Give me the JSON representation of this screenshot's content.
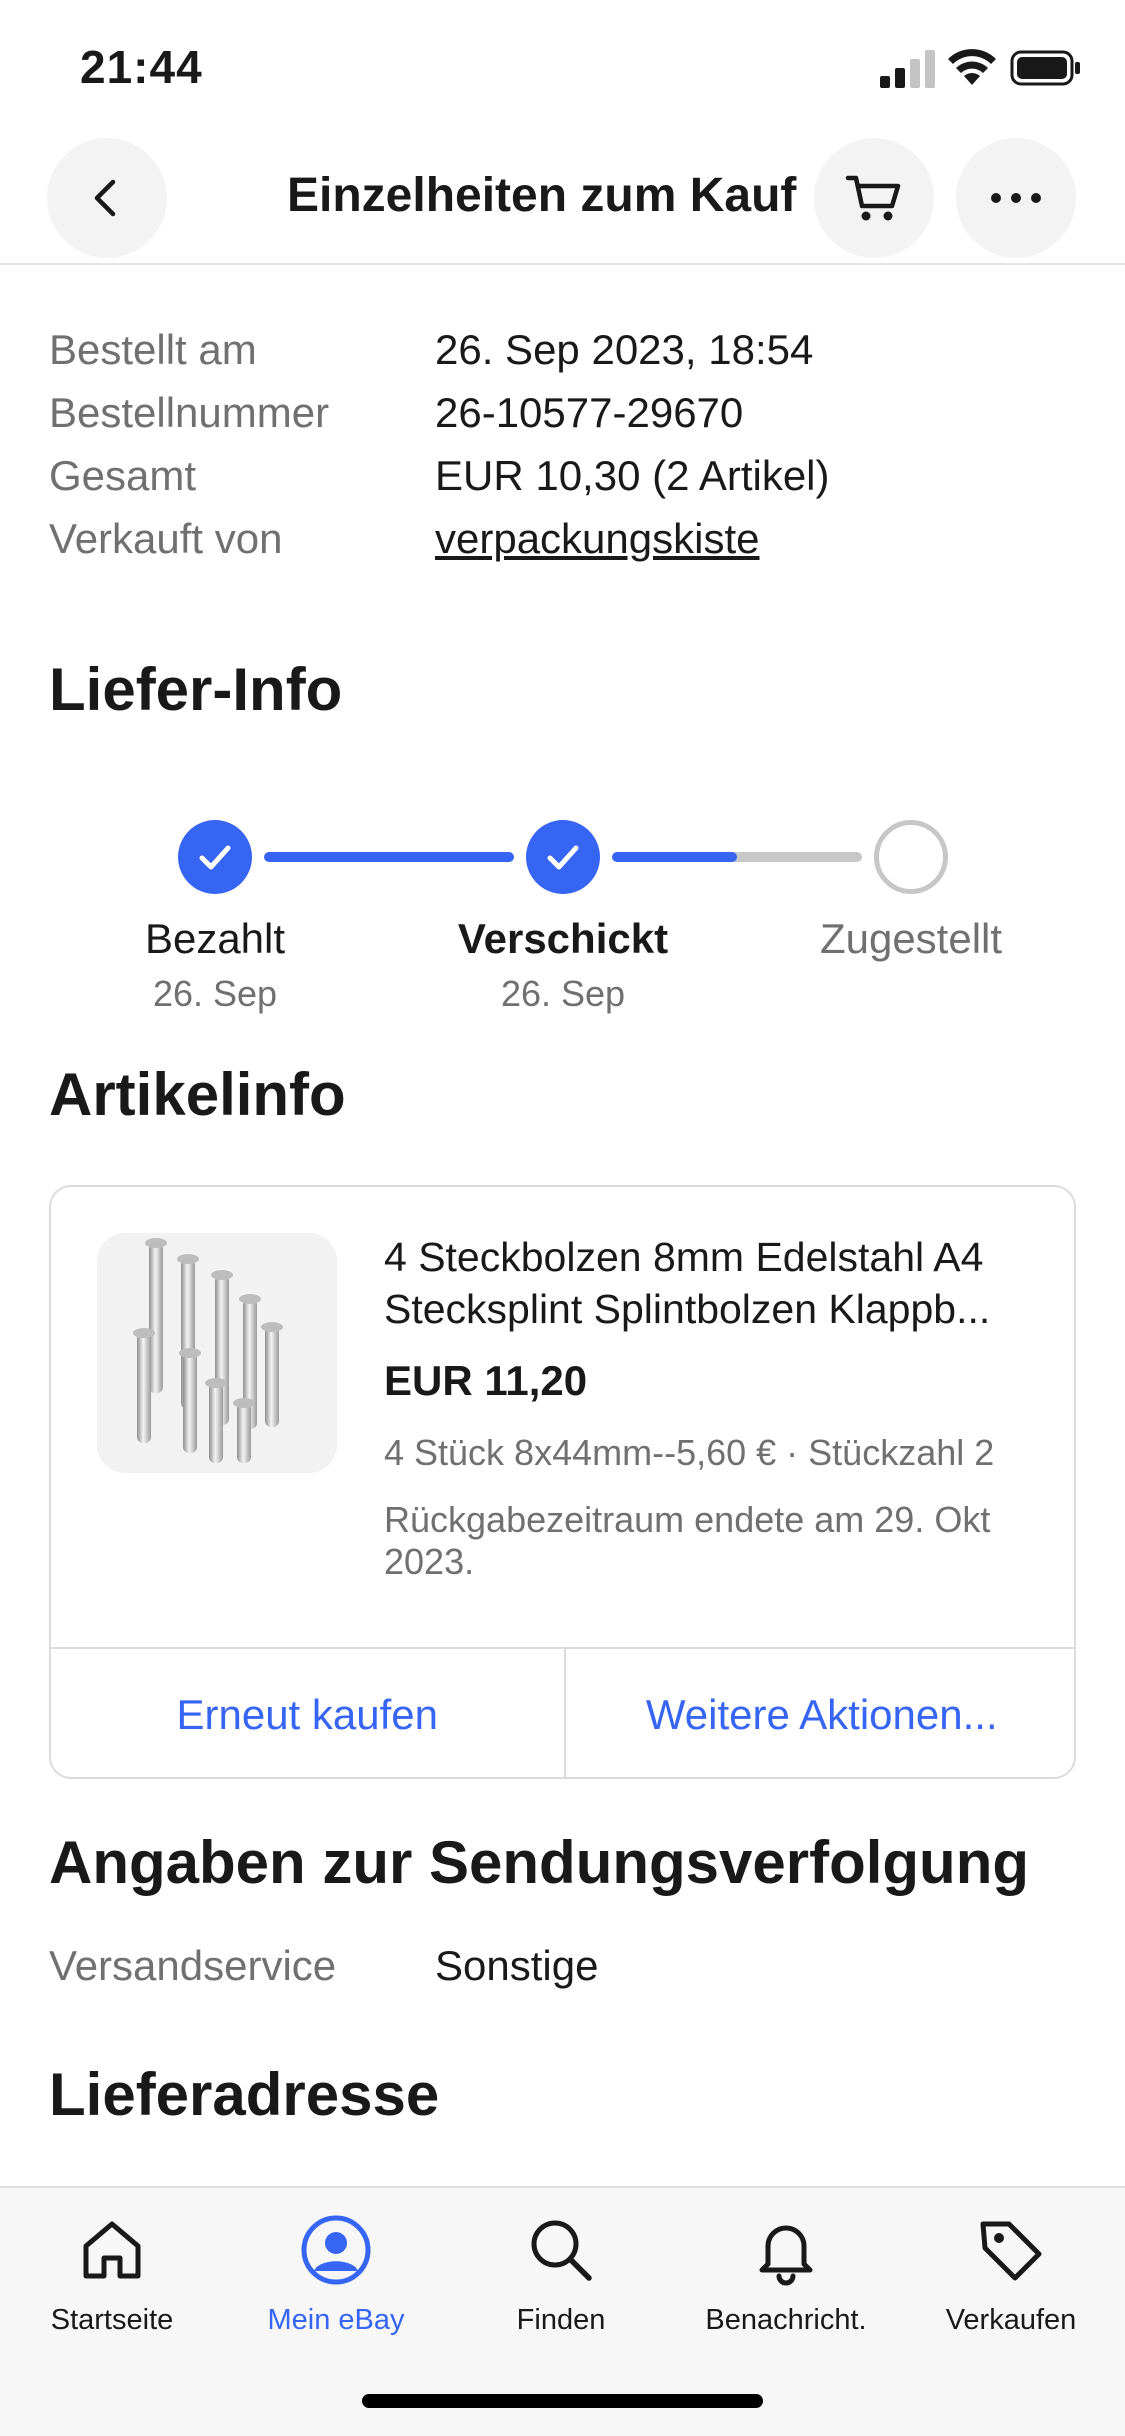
{
  "status_bar": {
    "time": "21:44"
  },
  "nav": {
    "title": "Einzelheiten zum Kauf",
    "back_icon": "chevron-left-icon",
    "cart_icon": "cart-icon",
    "more_icon": "more-horizontal-icon"
  },
  "order": {
    "rows": [
      {
        "label": "Bestellt am",
        "value": "26. Sep 2023, 18:54"
      },
      {
        "label": "Bestellnummer",
        "value": "26-10577-29670"
      },
      {
        "label": "Gesamt",
        "value": "EUR 10,30 (2 Artikel)"
      },
      {
        "label": "Verkauft von",
        "value": "verpackungskiste"
      }
    ]
  },
  "delivery": {
    "heading": "Liefer-Info",
    "steps": [
      {
        "label": "Bezahlt",
        "date": "26. Sep",
        "state": "done"
      },
      {
        "label": "Verschickt",
        "date": "26. Sep",
        "state": "done"
      },
      {
        "label": "Zugestellt",
        "date": "",
        "state": "pending"
      }
    ],
    "transit_progress": 0.5
  },
  "item_info": {
    "heading": "Artikelinfo",
    "title": "4 Steckbolzen 8mm Edelstahl A4 Stecksplint Splintbolzen Klappb...",
    "price": "EUR 11,20",
    "variant": "4 Stück 8x44mm--5,60 € · Stückzahl 2",
    "return_note": "Rückgabezeitraum endete am 29. Okt 2023.",
    "actions": {
      "buy_again": "Erneut kaufen",
      "more_actions": "Weitere Aktionen..."
    }
  },
  "tracking": {
    "heading": "Angaben zur Sendungsverfolgung",
    "service_label": "Versandservice",
    "service_value": "Sonstige"
  },
  "address": {
    "heading": "Lieferadresse"
  },
  "tab_bar": {
    "tabs": [
      {
        "label": "Startseite",
        "icon": "home-icon"
      },
      {
        "label": "Mein eBay",
        "icon": "user-icon",
        "active": true
      },
      {
        "label": "Finden",
        "icon": "search-icon"
      },
      {
        "label": "Benachricht.",
        "icon": "bell-icon"
      },
      {
        "label": "Verkaufen",
        "icon": "tag-icon"
      }
    ]
  },
  "colors": {
    "accent": "#3665f3",
    "text": "#191919",
    "muted": "#707070",
    "pending": "#c7c7c7"
  }
}
